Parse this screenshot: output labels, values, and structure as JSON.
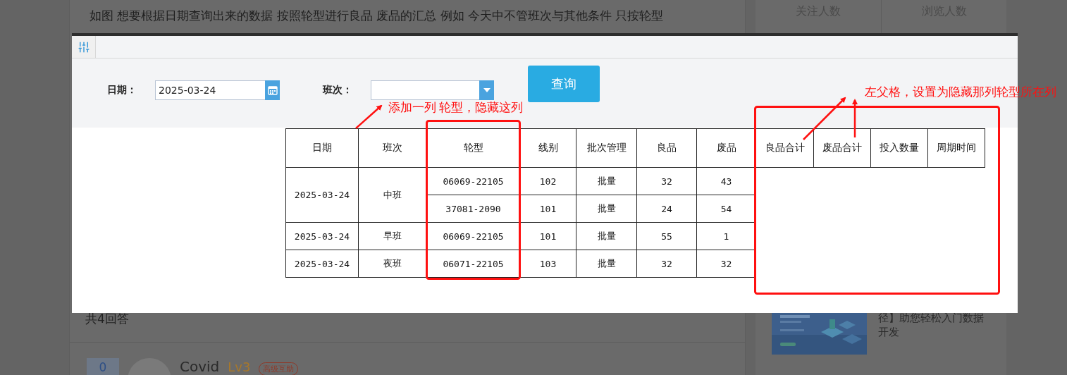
{
  "question": {
    "text": "如图 想要根据日期查询出来的数据  按照轮型进行良品 废品的汇总   例如 今天中不管班次与其他条件 只按轮型"
  },
  "sidebar": {
    "stats": [
      "关注人数",
      "浏览人数"
    ],
    "promo_lines": [
      "径】助您轻松入门数据",
      "开发"
    ]
  },
  "answers": {
    "count": "共4回答",
    "first": {
      "votes": "0",
      "author": "Covid",
      "level": "Lv3",
      "badge": "高级互助"
    }
  },
  "dialog": {
    "filters": [
      {
        "kind": "date",
        "label": "日期：",
        "value": "2025-03-24"
      },
      {
        "kind": "select",
        "label": "班次："
      }
    ],
    "query_button": "查询",
    "table": {
      "columns": [
        "日期",
        "班次",
        "轮型",
        "线别",
        "批次管理",
        "良品",
        "废品",
        "良品合计",
        "废品合计",
        "投入数量",
        "周期时间"
      ],
      "groups": [
        {
          "date": "2025-03-24",
          "shift": "中班",
          "items": [
            {
              "wheel": "06069-22105",
              "line": "102",
              "batch": "批量",
              "good": "32",
              "scrap": "43"
            },
            {
              "wheel": "37081-2090",
              "line": "101",
              "batch": "批量",
              "good": "24",
              "scrap": "54"
            }
          ]
        },
        {
          "date": "2025-03-24",
          "shift": "早班",
          "items": [
            {
              "wheel": "06069-22105",
              "line": "101",
              "batch": "批量",
              "good": "55",
              "scrap": "1"
            }
          ]
        },
        {
          "date": "2025-03-24",
          "shift": "夜班",
          "items": [
            {
              "wheel": "06071-22105",
              "line": "103",
              "batch": "批量",
              "good": "32",
              "scrap": "32"
            }
          ]
        }
      ]
    }
  },
  "annotations": [
    {
      "text": "添加一列 轮型，隐藏这列"
    },
    {
      "text": "左父格，设置为隐藏那列轮型所在列"
    }
  ]
}
